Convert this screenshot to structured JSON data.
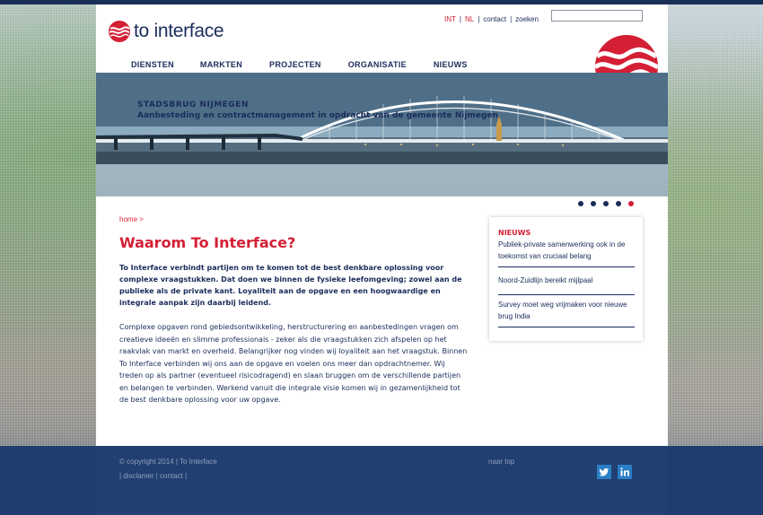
{
  "brand": {
    "name": "to interface",
    "accent": "#d41f35",
    "navy": "#1a2c5a"
  },
  "toplinks": {
    "int": "INT",
    "nl": "NL",
    "contact": "contact",
    "zoeken": "zoeken",
    "sep": "|"
  },
  "search": {
    "placeholder": ""
  },
  "nav": [
    "DIENSTEN",
    "MARKTEN",
    "PROJECTEN",
    "ORGANISATIE",
    "NIEUWS"
  ],
  "hero": {
    "title": "STADSBRUG NIJMEGEN",
    "subtitle": "Aanbesteding en contractmanagement in opdracht van de gemeente Nijmegen",
    "slides": 5,
    "active_slide": 5
  },
  "breadcrumb": "home >",
  "page_title": "Waarom To Interface?",
  "intro": "To Interface verbindt partijen om te komen tot de best denkbare oplossing voor complexe vraagstukken. Dat doen we binnen de fysieke leefomgeving; zowel aan de publieke als de private kant. Loyaliteit aan de opgave en een hoogwaardige en integrale aanpak zijn daarbij leidend.",
  "body": "Complexe opgaven rond gebiedsontwikkeling, herstructurering en aanbestedingen vragen om creatieve ideeën en slimme professionals - zeker als die vraagstukken zich afspelen op het raakvlak van markt en overheid. Belangrijker nog vinden wij loyaliteit aan het vraagstuk. Binnen To Interface verbinden wij ons aan de opgave en voelen ons meer dan opdrachtnemer. Wij treden op als partner (eventueel risicodragend) en slaan bruggen om de verschillende partijen en belangen te verbinden. Werkend vanuit die integrale visie komen wij in gezamenlijkheid tot de best denkbare oplossing voor uw opgave.",
  "news": {
    "heading": "NIEUWS",
    "items": [
      "Publiek-private samenwerking ook in de toekomst van cruciaal belang",
      "Noord-Zuidlijn bereikt mijlpaal",
      "Survey moet weg vrijmaken voor nieuwe brug India"
    ]
  },
  "footer": {
    "copyright": "© copyright 2014   |   To Interface",
    "links": "|   disclamer   |   contact   |",
    "top": "naar top",
    "twitter": "twitter-icon",
    "linkedin": "linkedin-icon"
  }
}
